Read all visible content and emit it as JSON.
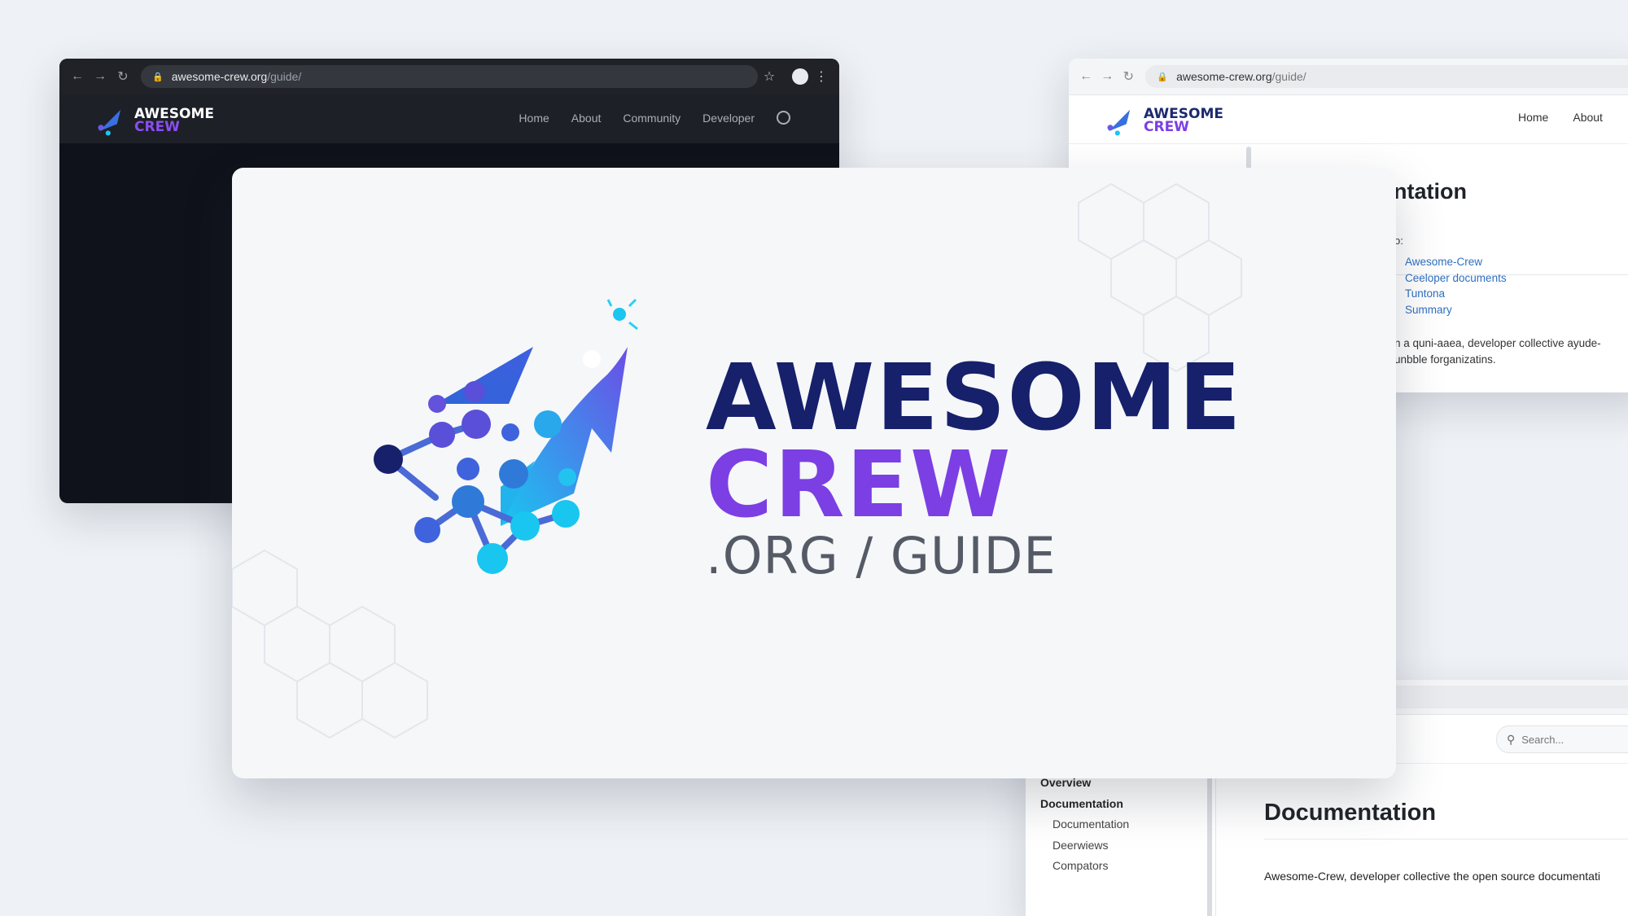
{
  "brand": {
    "line1": "AWESOME",
    "line2": "CREW",
    "suffix": ".ORG / GUIDE",
    "colors": {
      "navy": "#16206b",
      "purple": "#7b3fe4",
      "cyan": "#19c6f0",
      "blue": "#3a56d4",
      "gray": "#555b66"
    }
  },
  "url": {
    "domain": "awesome-crew.org",
    "path": "/guide/"
  },
  "dark_window": {
    "nav": [
      "Home",
      "About",
      "Community",
      "Developer"
    ],
    "icons": [
      "back-icon",
      "forward-icon",
      "reload-icon",
      "lock-icon",
      "star-icon",
      "account-icon",
      "menu-icon",
      "github-icon"
    ]
  },
  "right_window": {
    "nav": [
      "Home",
      "About"
    ],
    "heading_fragment": "ntation",
    "intro_fragment": "o:",
    "toc": [
      "Awesome-Crew",
      "Ceeloper documents",
      "Tuntona",
      "Summary"
    ],
    "para_line1": "n a quni-aaea, developer collective  ayude-",
    "para_line2": "unbble forganizatins."
  },
  "bottom_window": {
    "search_placeholder": "Search...",
    "sidebar": [
      "Overview",
      "Documentation",
      "Documentation",
      "Deerwiews",
      "Compators"
    ],
    "heading": "Documentation",
    "para": "Awesome-Crew, developer collective the open source documentati"
  }
}
